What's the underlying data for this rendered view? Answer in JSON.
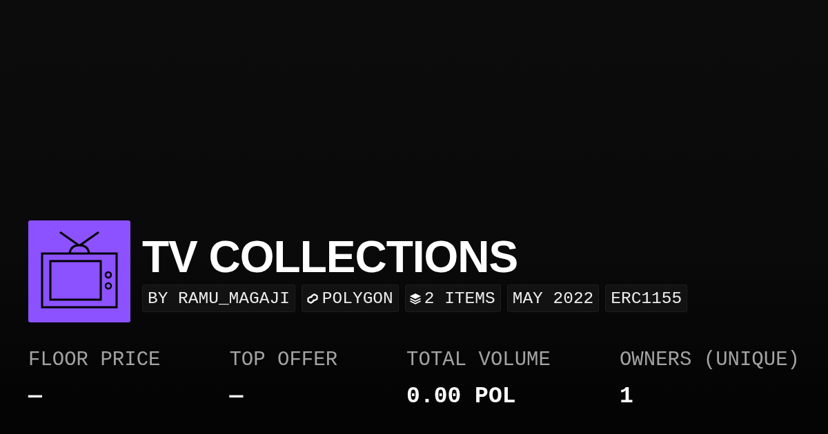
{
  "collection": {
    "title": "TV COLLECTIONS",
    "tags": [
      {
        "kind": "text",
        "label": "BY RAMU_MAGAJI"
      },
      {
        "kind": "chain",
        "label": "POLYGON"
      },
      {
        "kind": "items",
        "label": "2 ITEMS"
      },
      {
        "kind": "text",
        "label": "MAY 2022"
      },
      {
        "kind": "text",
        "label": "ERC1155"
      }
    ]
  },
  "stats": [
    {
      "label": "FLOOR PRICE",
      "value": "—"
    },
    {
      "label": "TOP OFFER",
      "value": "—"
    },
    {
      "label": "TOTAL VOLUME",
      "value": "0.00 POL"
    },
    {
      "label": "OWNERS (UNIQUE)",
      "value": "1"
    }
  ]
}
